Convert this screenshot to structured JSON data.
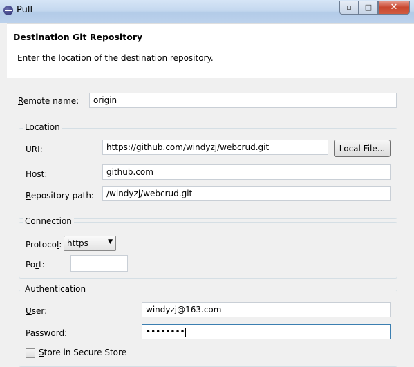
{
  "window": {
    "title": "Pull"
  },
  "header": {
    "title": "Destination Git Repository",
    "description": "Enter the location of the destination repository."
  },
  "remote": {
    "label_accel": "R",
    "label_rest": "emote name:",
    "value": "origin"
  },
  "location": {
    "legend": "Location",
    "uri_label_pre": "UR",
    "uri_label_accel": "I",
    "uri_label_post": ":",
    "uri_value": "https://github.com/windyzj/webcrud.git",
    "local_file_button": "Local File...",
    "host_label_accel": "H",
    "host_label_rest": "ost:",
    "host_value": "github.com",
    "repo_label_accel": "R",
    "repo_label_rest": "epository path:",
    "repo_value": "/windyzj/webcrud.git"
  },
  "connection": {
    "legend": "Connection",
    "protocol_label_pre": "Protoco",
    "protocol_label_accel": "l",
    "protocol_label_post": ":",
    "protocol_value": "https",
    "port_label_pre": "Po",
    "port_label_accel": "r",
    "port_label_post": "t:",
    "port_value": ""
  },
  "authentication": {
    "legend": "Authentication",
    "user_label_accel": "U",
    "user_label_rest": "ser:",
    "user_value": "windyzj@163.com",
    "password_label_accel": "P",
    "password_label_rest": "assword:",
    "password_mask": "••••••••",
    "store_label_accel": "S",
    "store_label_rest": "tore in Secure Store"
  }
}
